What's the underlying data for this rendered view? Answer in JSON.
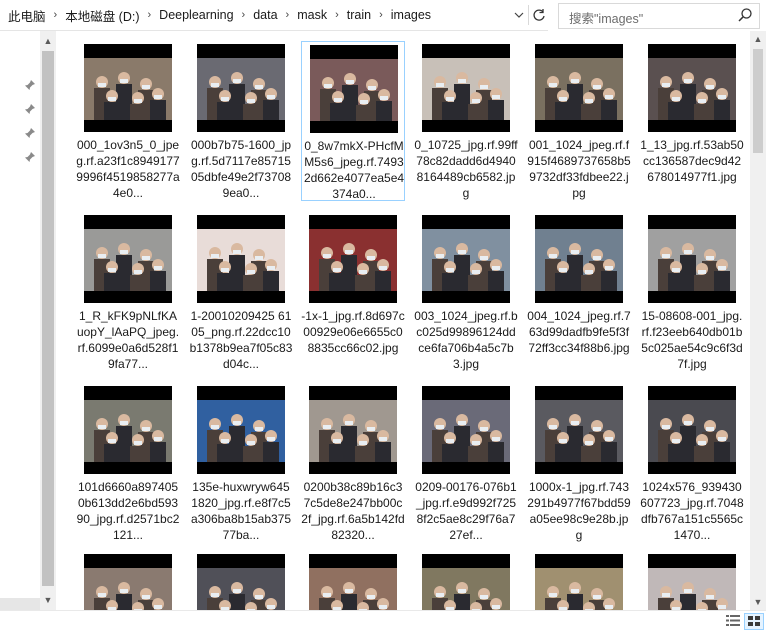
{
  "breadcrumbs": [
    "此电脑",
    "本地磁盘 (D:)",
    "Deeplearning",
    "data",
    "mask",
    "train",
    "images"
  ],
  "search": {
    "placeholder": "搜索\"images\""
  },
  "files": [
    {
      "name": "000_1ov3n5_0_jpeg.rf.a23f1c89491779996f4519858277a4e0...",
      "selected": false,
      "tone": "#8a7a6a"
    },
    {
      "name": "000b7b75-1600_jpg.rf.5d7117e8571505dbfe49e2f737089ea0...",
      "selected": false,
      "tone": "#6a6a72"
    },
    {
      "name": "0_8w7mkX-PHcfMM5s6_jpeg.rf.74932d662e4077ea5e4374a0...",
      "selected": true,
      "tone": "#7a5a5a"
    },
    {
      "name": "0_10725_jpg.rf.99ff78c82dadd6d49408164489cb6582.jpg",
      "selected": false,
      "tone": "#c8c0b8"
    },
    {
      "name": "001_1024_jpeg.rf.f915f4689737658b59732df33fdbee22.jpg",
      "selected": false,
      "tone": "#7a7060"
    },
    {
      "name": "1_13_jpg.rf.53ab50cc136587dec9d42678014977f1.jpg",
      "selected": false,
      "tone": "#5a5050"
    },
    {
      "name": "1_R_kFK9pNLfKAuopY_lAaPQ_jpeg.rf.6099e0a6d528f19fa77...",
      "selected": false,
      "tone": "#9a9a98"
    },
    {
      "name": "1-20010209425 6105_png.rf.22dcc10b1378b9ea7f05c83d04c...",
      "selected": false,
      "tone": "#e8dcd8"
    },
    {
      "name": "-1x-1_jpg.rf.8d697c00929e06e6655c08835cc66c02.jpg",
      "selected": false,
      "tone": "#8a3030"
    },
    {
      "name": "003_1024_jpeg.rf.bc025d99896124ddce6fa706b4a5c7b3.jpg",
      "selected": false,
      "tone": "#8090a0"
    },
    {
      "name": "004_1024_jpeg.rf.763d99dadfb9fe5f3f72ff3cc34f88b6.jpg",
      "selected": false,
      "tone": "#708090"
    },
    {
      "name": "15-08608-001_jpg.rf.f23eeb640db01b5c025ae54c9c6f3d7f.jpg",
      "selected": false,
      "tone": "#a0a0a0"
    },
    {
      "name": "101d6660a8974050b613dd2e6bd59390_jpg.rf.d2571bc2121...",
      "selected": false,
      "tone": "#7a7a70"
    },
    {
      "name": "135e-huxwryw6451820_jpg.rf.e8f7c5a306ba8b15ab37577ba...",
      "selected": false,
      "tone": "#3060a0"
    },
    {
      "name": "0200b38c89b16c37c5de8e247bb00c2f_jpg.rf.6a5b142fd82320...",
      "selected": false,
      "tone": "#a09890"
    },
    {
      "name": "0209-00176-076b1_jpg.rf.e9d992f7258f2c5ae8c29f76a727ef...",
      "selected": false,
      "tone": "#6a6a78"
    },
    {
      "name": "1000x-1_jpg.rf.743291b4977f67bdd59a05ee98c9e28b.jpg",
      "selected": false,
      "tone": "#5a5a60"
    },
    {
      "name": "1024x576_939430607723_jpg.rf.7048dfb767a151c5565c1470...",
      "selected": false,
      "tone": "#4a4a50"
    },
    {
      "name": "",
      "selected": false,
      "tone": "#8a7a70"
    },
    {
      "name": "",
      "selected": false,
      "tone": "#505058"
    },
    {
      "name": "",
      "selected": false,
      "tone": "#907060"
    },
    {
      "name": "",
      "selected": false,
      "tone": "#807860"
    },
    {
      "name": "",
      "selected": false,
      "tone": "#a09070"
    },
    {
      "name": "",
      "selected": false,
      "tone": "#c0b8b8"
    }
  ],
  "colors": {
    "selection_border": "#99d1ff",
    "accent": "#0078d7"
  },
  "icons": {
    "pin": "pin-icon",
    "search": "search-icon",
    "refresh": "refresh-icon",
    "details_view": "details-view-icon",
    "large_icons_view": "large-icons-view-icon"
  }
}
